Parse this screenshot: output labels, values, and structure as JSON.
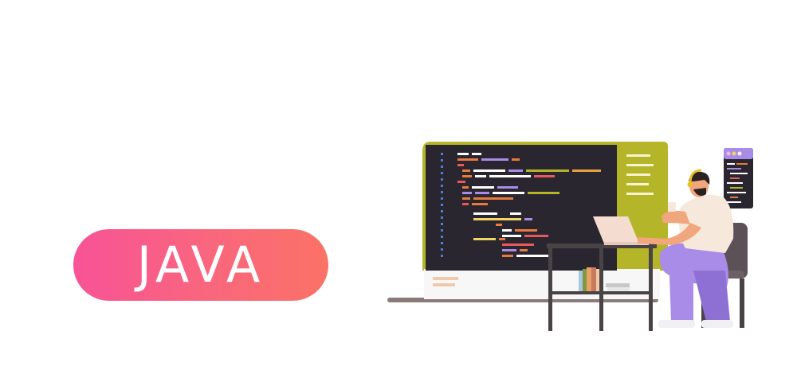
{
  "hero": {
    "title": "",
    "badge_label": "JAVA"
  },
  "illustration": {
    "subject": "developer-at-desk-with-code-monitor-icon",
    "colors": {
      "monitor_frame": "#b5b52a",
      "screen": "#2a2630",
      "pants": "#a98be8",
      "chair": "#5c5156",
      "desk": "#4a4346",
      "skin": "#f1a67e",
      "shirt": "#f6e9dc"
    }
  },
  "colors": {
    "pill_start": "#f85396",
    "pill_end": "#fb7266",
    "pill_text": "#ffffff",
    "background": "#ffffff"
  }
}
